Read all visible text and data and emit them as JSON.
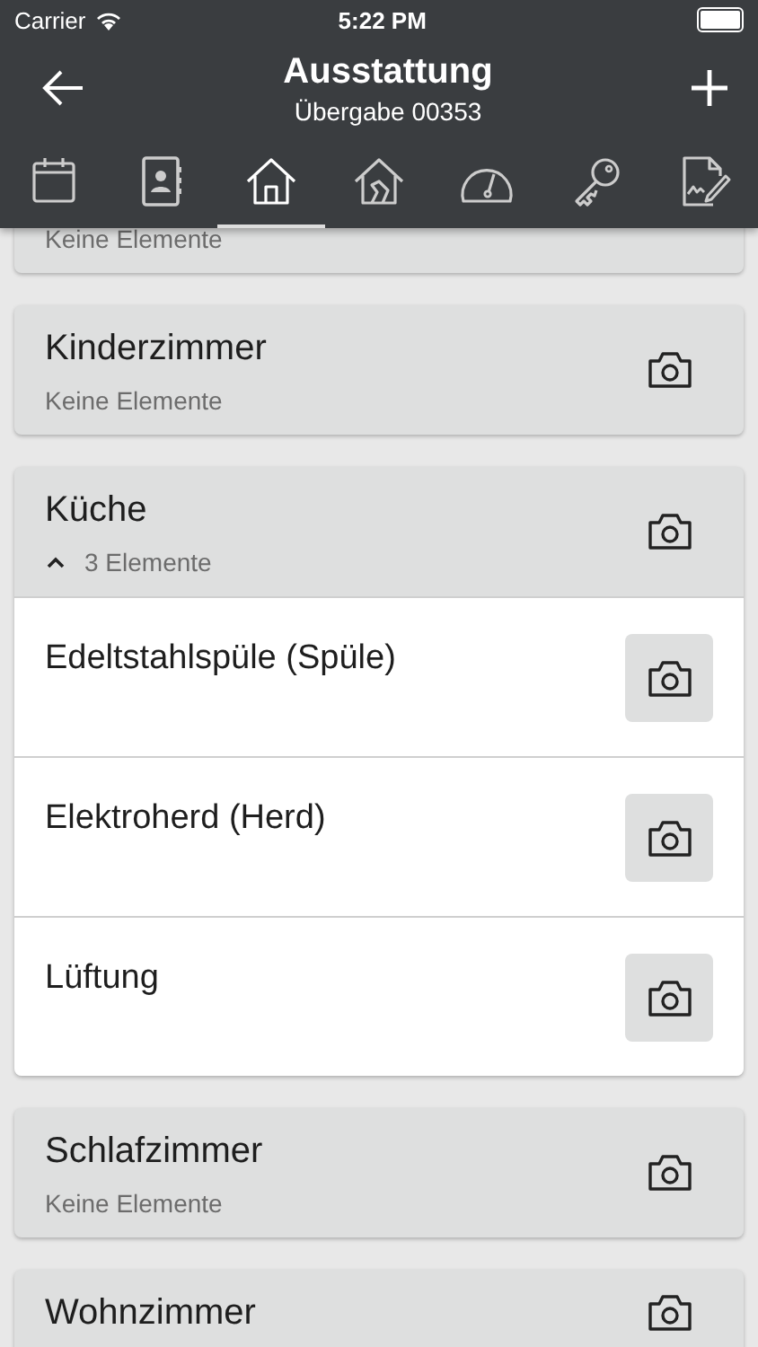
{
  "status_bar": {
    "carrier": "Carrier",
    "time": "5:22 PM"
  },
  "header": {
    "title": "Ausstattung",
    "subtitle": "Übergabe 00353"
  },
  "tabs": [
    {
      "kind": "calendar",
      "selected": false
    },
    {
      "kind": "contacts",
      "selected": false
    },
    {
      "kind": "home",
      "selected": true
    },
    {
      "kind": "rooms",
      "selected": false
    },
    {
      "kind": "meter",
      "selected": false
    },
    {
      "kind": "key",
      "selected": false
    },
    {
      "kind": "signature",
      "selected": false
    }
  ],
  "rooms": [
    {
      "subtitle": "Keine Elemente"
    },
    {
      "title": "Kinderzimmer",
      "subtitle": "Keine Elemente"
    },
    {
      "title": "Küche",
      "subtitle": "3 Elemente",
      "expanded": true,
      "children": [
        {
          "title": "Edeltstahlspüle (Spüle)"
        },
        {
          "title": "Elektroherd (Herd)"
        },
        {
          "title": "Lüftung"
        }
      ]
    },
    {
      "title": "Schlafzimmer",
      "subtitle": "Keine Elemente"
    },
    {
      "title": "Wohnzimmer"
    }
  ]
}
